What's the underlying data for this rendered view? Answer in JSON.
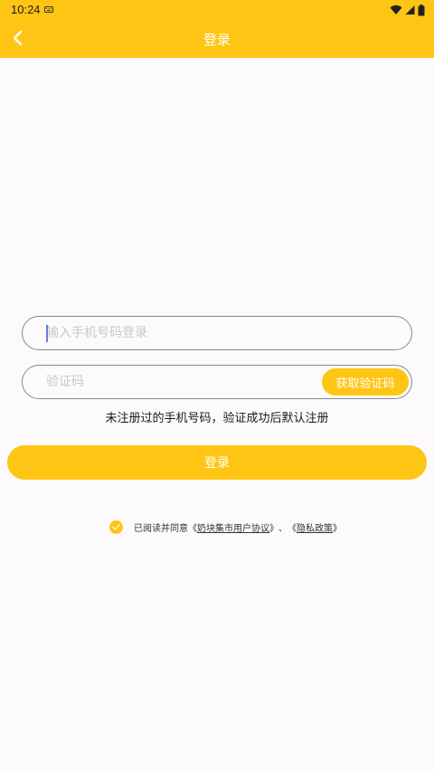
{
  "status_bar": {
    "time": "10:24"
  },
  "header": {
    "title": "登录"
  },
  "form": {
    "phone_placeholder": "输入手机号码登录",
    "code_placeholder": "验证码",
    "get_code_label": "获取验证码",
    "hint": "未注册过的手机号码，验证成功后默认注册",
    "login_label": "登录"
  },
  "agreement": {
    "checked": true,
    "prefix": "已阅读并同意",
    "open_bracket_1": "《",
    "user_agreement": "奶块集市用户协议",
    "close_bracket_1": "》",
    "separator": "、",
    "open_bracket_2": "《",
    "privacy_policy": "隐私政策",
    "close_bracket_2": "》"
  },
  "colors": {
    "accent": "#ffc515",
    "background": "#fdfafd"
  },
  "icons": {
    "back": "chevron-left-icon",
    "check": "check-icon",
    "wifi": "wifi-icon",
    "signal": "signal-icon",
    "battery": "battery-icon"
  }
}
